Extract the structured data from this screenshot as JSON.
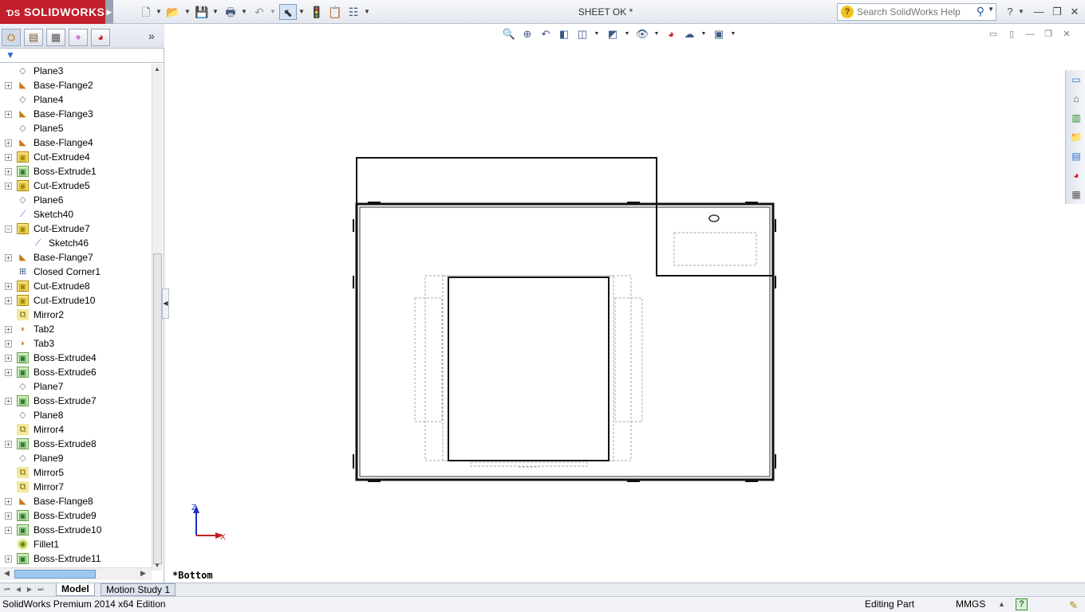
{
  "app": {
    "brand": "SOLIDWORKS",
    "document_title": "SHEET OK *"
  },
  "search": {
    "placeholder": "Search SolidWorks Help"
  },
  "toolbar": {
    "icons": [
      "new-document-icon",
      "open-icon",
      "save-icon",
      "print-icon",
      "undo-icon",
      "select-icon",
      "rebuild-icon",
      "file-properties-icon",
      "options-icon"
    ]
  },
  "view_toolbar": {
    "icons": [
      "zoom-to-fit-icon",
      "zoom-to-area-icon",
      "previous-view-icon",
      "section-view-icon",
      "view-orientation-icon",
      "display-style-icon",
      "hide-show-items-icon",
      "edit-appearance-icon",
      "apply-scene-icon",
      "view-settings-icon"
    ]
  },
  "feature_manager": {
    "tabs": [
      "featuremanager-tree-icon",
      "propertymanager-icon",
      "configurationmanager-icon",
      "dimxpertmanager-icon",
      "displaymanager-icon"
    ],
    "items": [
      {
        "label": "Plane3",
        "type": "plane",
        "expandable": false
      },
      {
        "label": "Base-Flange2",
        "type": "flange",
        "expandable": true
      },
      {
        "label": "Plane4",
        "type": "plane",
        "expandable": false
      },
      {
        "label": "Base-Flange3",
        "type": "flange",
        "expandable": true
      },
      {
        "label": "Plane5",
        "type": "plane",
        "expandable": false
      },
      {
        "label": "Base-Flange4",
        "type": "flange",
        "expandable": true
      },
      {
        "label": "Cut-Extrude4",
        "type": "cut",
        "expandable": true
      },
      {
        "label": "Boss-Extrude1",
        "type": "boss",
        "expandable": true
      },
      {
        "label": "Cut-Extrude5",
        "type": "cut",
        "expandable": true
      },
      {
        "label": "Plane6",
        "type": "plane",
        "expandable": false
      },
      {
        "label": "Sketch40",
        "type": "sketch",
        "expandable": false
      },
      {
        "label": "Cut-Extrude7",
        "type": "cut",
        "expandable": true,
        "expanded": true
      },
      {
        "label": "Sketch46",
        "type": "sketch",
        "expandable": false,
        "child": true
      },
      {
        "label": "Base-Flange7",
        "type": "flange",
        "expandable": true
      },
      {
        "label": "Closed Corner1",
        "type": "corner",
        "expandable": false
      },
      {
        "label": "Cut-Extrude8",
        "type": "cut",
        "expandable": true
      },
      {
        "label": "Cut-Extrude10",
        "type": "cut",
        "expandable": true
      },
      {
        "label": "Mirror2",
        "type": "mirror",
        "expandable": false
      },
      {
        "label": "Tab2",
        "type": "tab",
        "expandable": true
      },
      {
        "label": "Tab3",
        "type": "tab",
        "expandable": true
      },
      {
        "label": "Boss-Extrude4",
        "type": "boss",
        "expandable": true
      },
      {
        "label": "Boss-Extrude6",
        "type": "boss",
        "expandable": true
      },
      {
        "label": "Plane7",
        "type": "plane",
        "expandable": false
      },
      {
        "label": "Boss-Extrude7",
        "type": "boss",
        "expandable": true
      },
      {
        "label": "Plane8",
        "type": "plane",
        "expandable": false
      },
      {
        "label": "Mirror4",
        "type": "mirror",
        "expandable": false
      },
      {
        "label": "Boss-Extrude8",
        "type": "boss",
        "expandable": true
      },
      {
        "label": "Plane9",
        "type": "plane",
        "expandable": false
      },
      {
        "label": "Mirror5",
        "type": "mirror",
        "expandable": false
      },
      {
        "label": "Mirror7",
        "type": "mirror",
        "expandable": false
      },
      {
        "label": "Base-Flange8",
        "type": "flange",
        "expandable": true
      },
      {
        "label": "Boss-Extrude9",
        "type": "boss",
        "expandable": true
      },
      {
        "label": "Boss-Extrude10",
        "type": "boss",
        "expandable": true
      },
      {
        "label": "Fillet1",
        "type": "fillet",
        "expandable": false
      },
      {
        "label": "Boss-Extrude11",
        "type": "boss",
        "expandable": true
      }
    ]
  },
  "viewport": {
    "view_label": "*Bottom",
    "triad": {
      "vertical_axis": "Z",
      "horizontal_axis": "X"
    }
  },
  "task_pane": {
    "icons": [
      "solidworks-resources-icon",
      "design-library-icon",
      "file-explorer-icon",
      "view-palette-icon",
      "appearances-icon",
      "custom-properties-icon"
    ]
  },
  "bottom_tabs": {
    "model": "Model",
    "motion_study": "Motion Study 1"
  },
  "status_bar": {
    "edition": "SolidWorks Premium 2014 x64 Edition",
    "mode": "Editing Part",
    "units": "MMGS"
  }
}
